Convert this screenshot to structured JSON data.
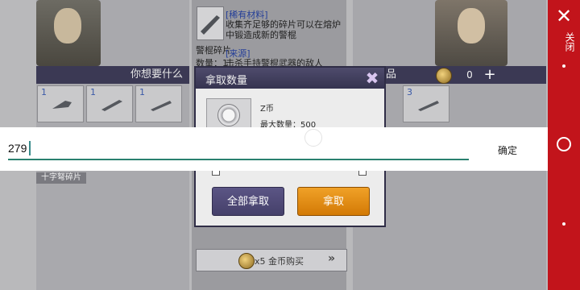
{
  "left_panel": {
    "header": "你想要什么",
    "slots": [
      "1",
      "1",
      "1"
    ],
    "tag": "十字弩碎片"
  },
  "middle_panel": {
    "item_name": "警棍碎片",
    "count_label": "数量：1",
    "rare_title": "[稀有材料]",
    "rare_desc": "收集齐足够的碎片可以在熔炉中锻造成新的警棍",
    "source_title": "[来源]",
    "source_desc": "击杀手持警棍武器的敌人",
    "buy_label": "x5 金币购买",
    "buy_arrow": "»"
  },
  "right_panel": {
    "header": "物品",
    "coin_value": "0",
    "plus": "+",
    "slot_count": "3"
  },
  "dialog": {
    "title": "拿取数量",
    "close": "✖",
    "item": "Z币",
    "max": "最大数量：500",
    "take_all": "全部拿取",
    "take": "拿取"
  },
  "input": {
    "value": "279",
    "confirm": "确定"
  },
  "sidebar": {
    "close": "✕",
    "label": "关闭"
  }
}
